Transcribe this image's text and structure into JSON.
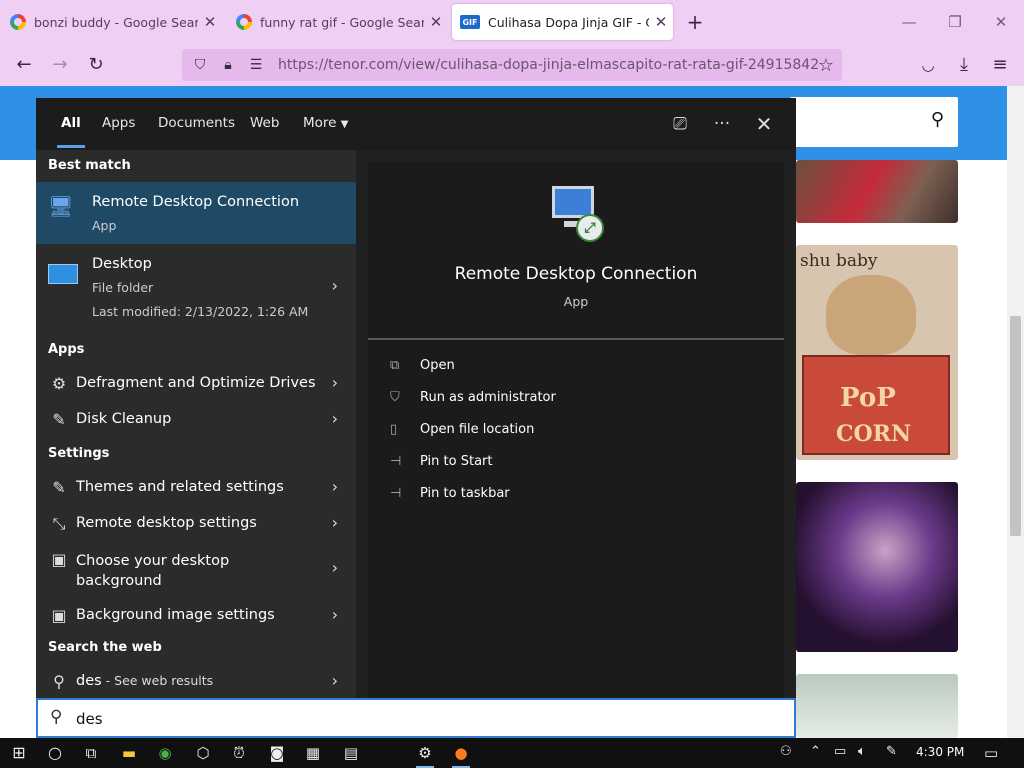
{
  "browser": {
    "tabs": [
      {
        "title": "bonzi buddy - Google Search",
        "icon": "google-icon"
      },
      {
        "title": "funny rat gif - Google Search",
        "icon": "google-icon"
      },
      {
        "title": "Culihasa Dopa Jinja GIF - Culiha",
        "icon": "gif-icon",
        "active": true
      }
    ],
    "new_tab_label": "+",
    "url": "https://tenor.com/view/culihasa-dopa-jinja-elmascapito-rat-rata-gif-24915842"
  },
  "page": {
    "thumb_caption": "shu baby",
    "thumb_text_1": "PoP",
    "thumb_text_2": "CORN"
  },
  "start_search": {
    "tabs": [
      "All",
      "Apps",
      "Documents",
      "Web",
      "More"
    ],
    "best_match_header": "Best match",
    "best_match": {
      "name": "Remote Desktop Connection",
      "type": "App"
    },
    "desktop": {
      "name": "Desktop",
      "type": "File folder",
      "modified": "Last modified: 2/13/2022, 1:26 AM"
    },
    "apps_header": "Apps",
    "apps": [
      "Defragment and Optimize Drives",
      "Disk Cleanup"
    ],
    "settings_header": "Settings",
    "settings": [
      "Themes and related settings",
      "Remote desktop settings",
      "Choose your desktop background",
      "Background image settings"
    ],
    "web_header": "Search the web",
    "web_query": "des",
    "web_suffix": " - See web results",
    "preview": {
      "name": "Remote Desktop Connection",
      "type": "App"
    },
    "actions": [
      "Open",
      "Run as administrator",
      "Open file location",
      "Pin to Start",
      "Pin to taskbar"
    ],
    "query": "des"
  },
  "taskbar": {
    "time": "4:30 PM"
  },
  "colors": {
    "tab_bg": "#f0cff4",
    "url_bg": "#e5b9ec",
    "page_header": "#2f91e6",
    "selected_result": "#1f4a66",
    "accent": "#2d7cd6"
  }
}
